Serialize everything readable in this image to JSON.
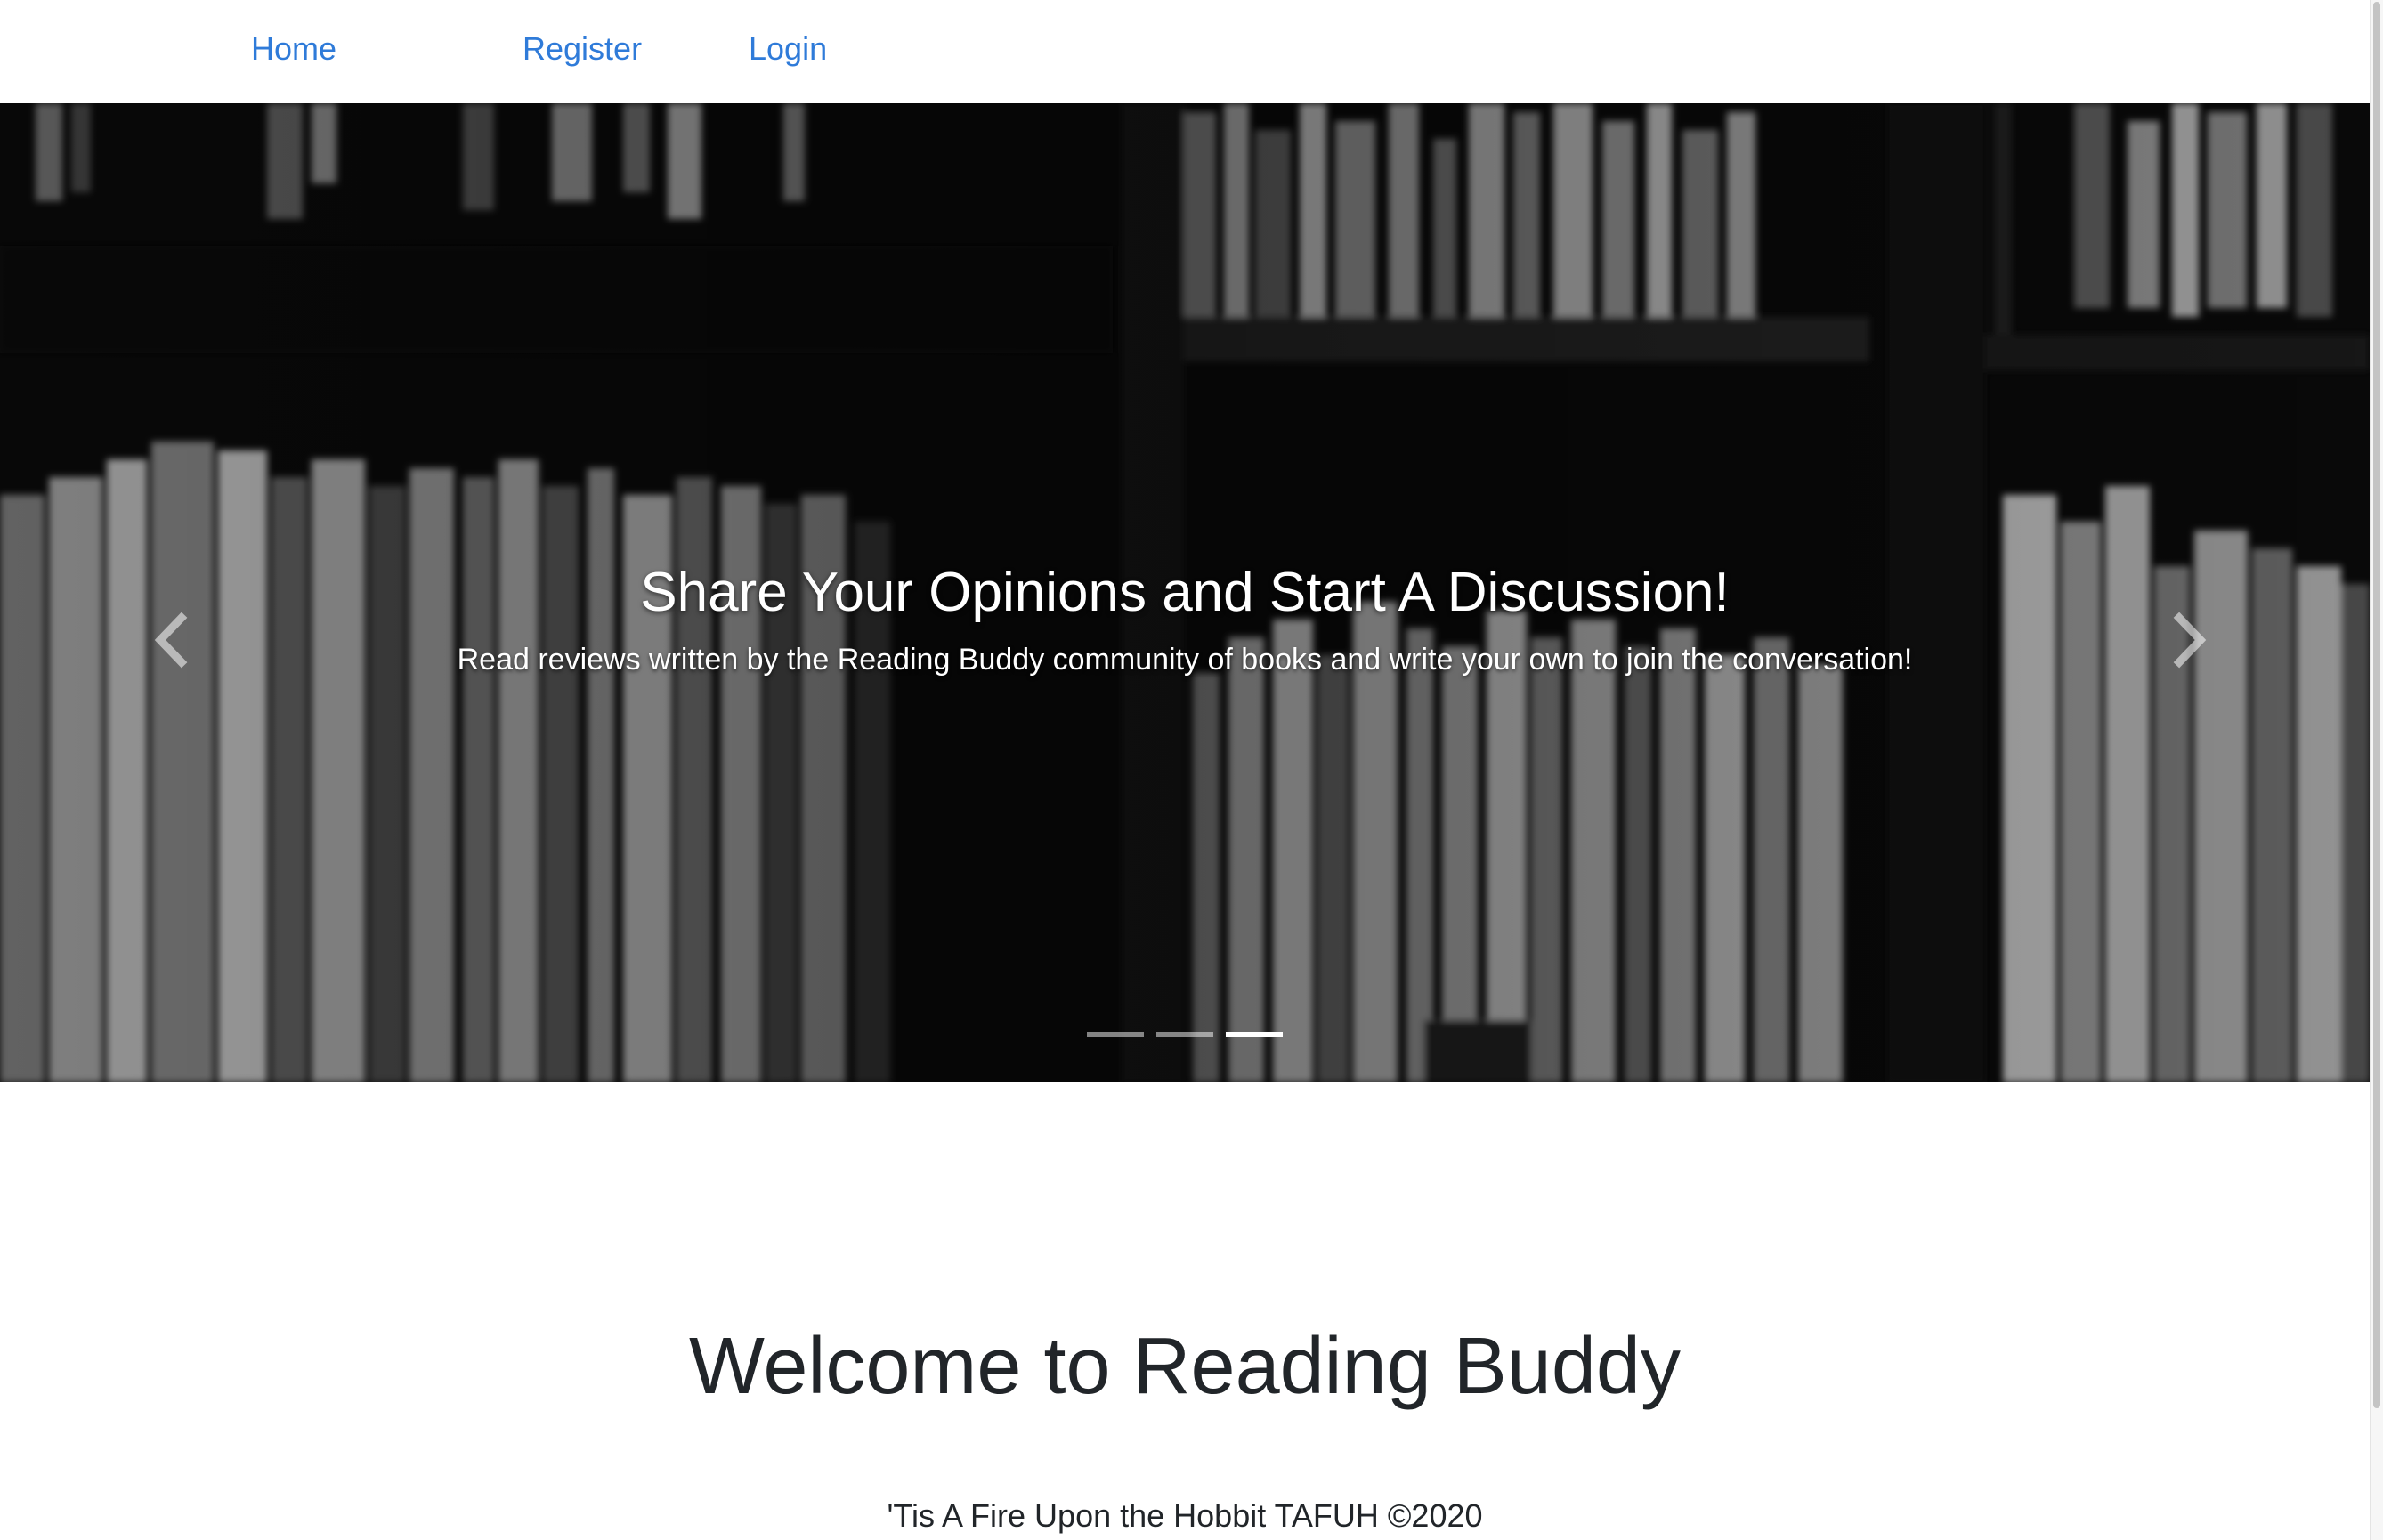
{
  "nav": {
    "home": "Home",
    "register": "Register",
    "login": "Login"
  },
  "carousel": {
    "title": "Share Your Opinions and Start A Discussion!",
    "text": "Read reviews written by the Reading Buddy community of books and write your own to join the conversation!",
    "slide_count": 3,
    "active_slide": 3,
    "prev_icon": "chevron-left-icon",
    "next_icon": "chevron-right-icon"
  },
  "welcome": {
    "title": "Welcome to Reading Buddy"
  },
  "footer": {
    "text": "'Tis A Fire Upon the Hobbit TAFUH ©2020"
  },
  "colors": {
    "link": "#2f7bd9",
    "text": "#212529",
    "caption": "#ffffff"
  }
}
